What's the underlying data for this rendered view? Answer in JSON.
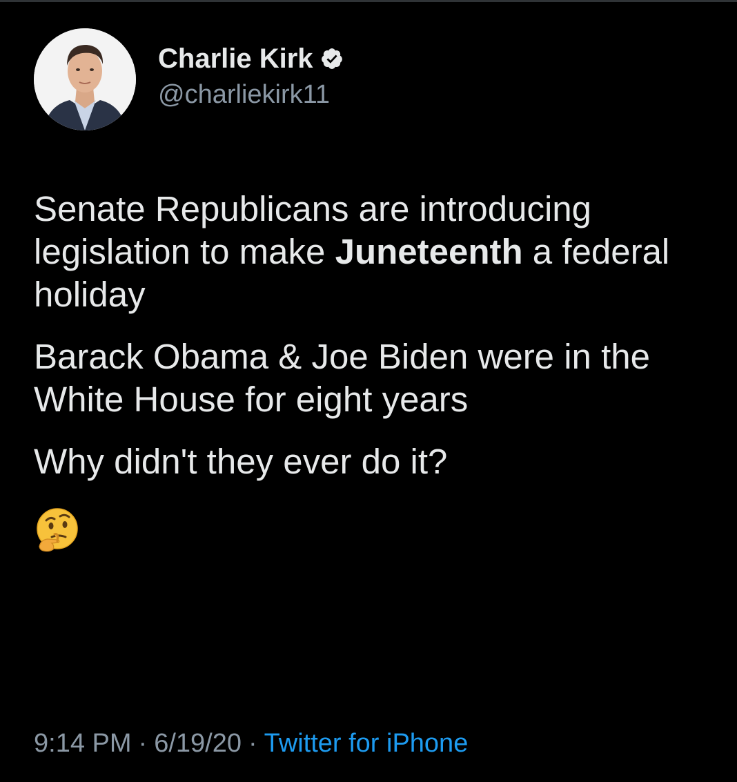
{
  "author": {
    "display_name": "Charlie Kirk",
    "handle": "@charliekirk11",
    "verified": true,
    "avatar_icon": "profile-photo",
    "verified_icon": "verified-badge-icon"
  },
  "tweet": {
    "paragraph1": {
      "part1": "Senate Republicans are introducing legislation to make ",
      "bold": "Juneteenth",
      "part2": " a federal holiday"
    },
    "paragraph2": "Barack Obama & Joe Biden were in the White House for eight years",
    "paragraph3": "Why didn't they ever do it?",
    "emoji": "thinking-face-emoji"
  },
  "footer": {
    "time": "9:14 PM",
    "date": "6/19/20",
    "separator": "·",
    "source": "Twitter for iPhone"
  },
  "colors": {
    "background": "#000000",
    "text": "#e7e9ea",
    "muted": "#8b98a5",
    "link": "#1d9bf0"
  }
}
